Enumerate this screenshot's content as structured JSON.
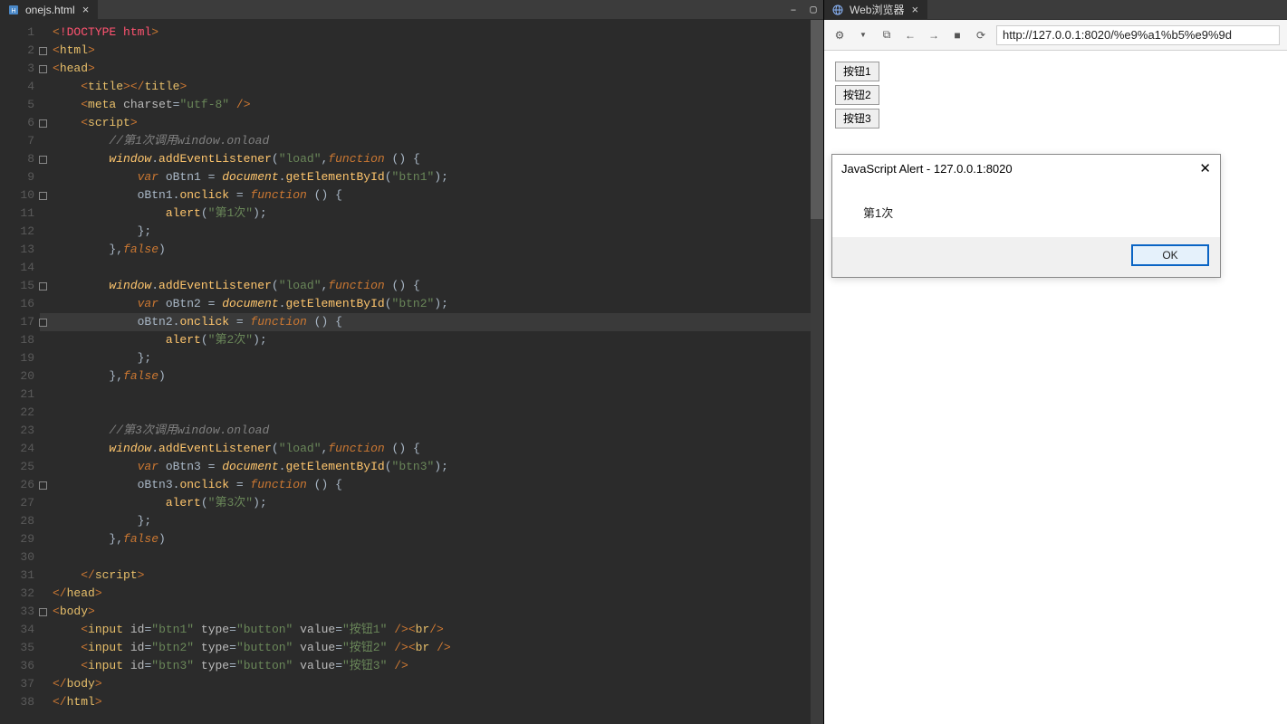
{
  "editor": {
    "tab": {
      "filename": "onejs.html",
      "icon": "html-file-icon"
    },
    "window_buttons": {
      "min": "–",
      "max": "▢"
    },
    "lines": [
      "<!DOCTYPE html>",
      "<html>",
      "<head>",
      "    <title></title>",
      "    <meta charset=\"utf-8\" />",
      "    <script>",
      "        //第1次调用window.onload",
      "        window.addEventListener(\"load\",function () {",
      "            var oBtn1 = document.getElementById(\"btn1\");",
      "            oBtn1.onclick = function () {",
      "                alert(\"第1次\");",
      "            };",
      "        },false)",
      "",
      "        window.addEventListener(\"load\",function () {",
      "            var oBtn2 = document.getElementById(\"btn2\");",
      "            oBtn2.onclick = function () {",
      "                alert(\"第2次\");",
      "            };",
      "        },false)",
      "",
      "",
      "        //第3次调用window.onload",
      "        window.addEventListener(\"load\",function () {",
      "            var oBtn3 = document.getElementById(\"btn3\");",
      "            oBtn3.onclick = function () {",
      "                alert(\"第3次\");",
      "            };",
      "        },false)",
      "",
      "    </script>",
      "</head>",
      "<body>",
      "    <input id=\"btn1\" type=\"button\" value=\"按钮1\" /><br/>",
      "    <input id=\"btn2\" type=\"button\" value=\"按钮2\" /><br />",
      "    <input id=\"btn3\" type=\"button\" value=\"按钮3\" />",
      "</body>",
      "</html>"
    ],
    "fold_lines": [
      2,
      3,
      6,
      8,
      10,
      15,
      17,
      26,
      33
    ],
    "highlighted_line": 17
  },
  "browser": {
    "tab": {
      "title": "Web浏览器",
      "icon": "globe-icon"
    },
    "toolbar": {
      "gear": "⚙",
      "popout": "⧉",
      "back": "←",
      "forward": "→",
      "stop": "■",
      "refresh": "⟳",
      "url": "http://127.0.0.1:8020/%e9%a1%b5%e9%9d"
    },
    "page": {
      "buttons": [
        "按钮1",
        "按钮2",
        "按钮3"
      ]
    },
    "alert": {
      "title": "JavaScript Alert - 127.0.0.1:8020",
      "message": "第1次",
      "ok": "OK"
    }
  }
}
